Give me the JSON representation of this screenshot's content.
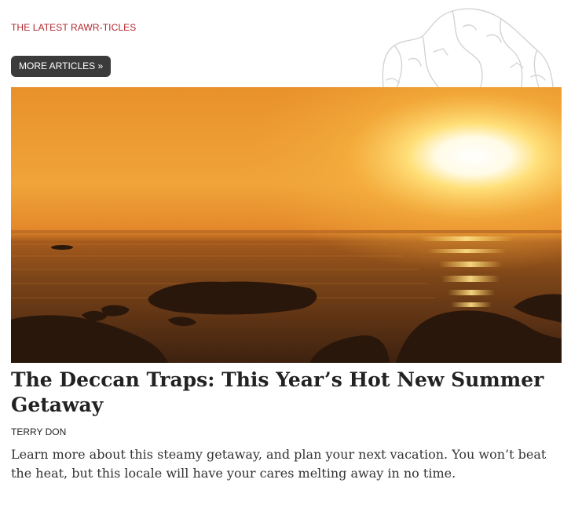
{
  "section": {
    "kicker": "THE LATEST RAWR-TICLES",
    "more_button_label": "MORE ARTICLES »"
  },
  "article": {
    "title": "The Deccan Traps: This Year’s Hot New Summer Getaway",
    "author": "TERRY DON",
    "excerpt": "Learn more about this steamy getaway, and plan your next vacation. You won’t beat the heat, but this locale will have your cares melting away in no time."
  },
  "icons": {
    "decor": "dinosaur-sketch-icon"
  },
  "colors": {
    "kicker": "#b0282d",
    "button_bg": "#3b3b3b",
    "title": "#222222"
  }
}
